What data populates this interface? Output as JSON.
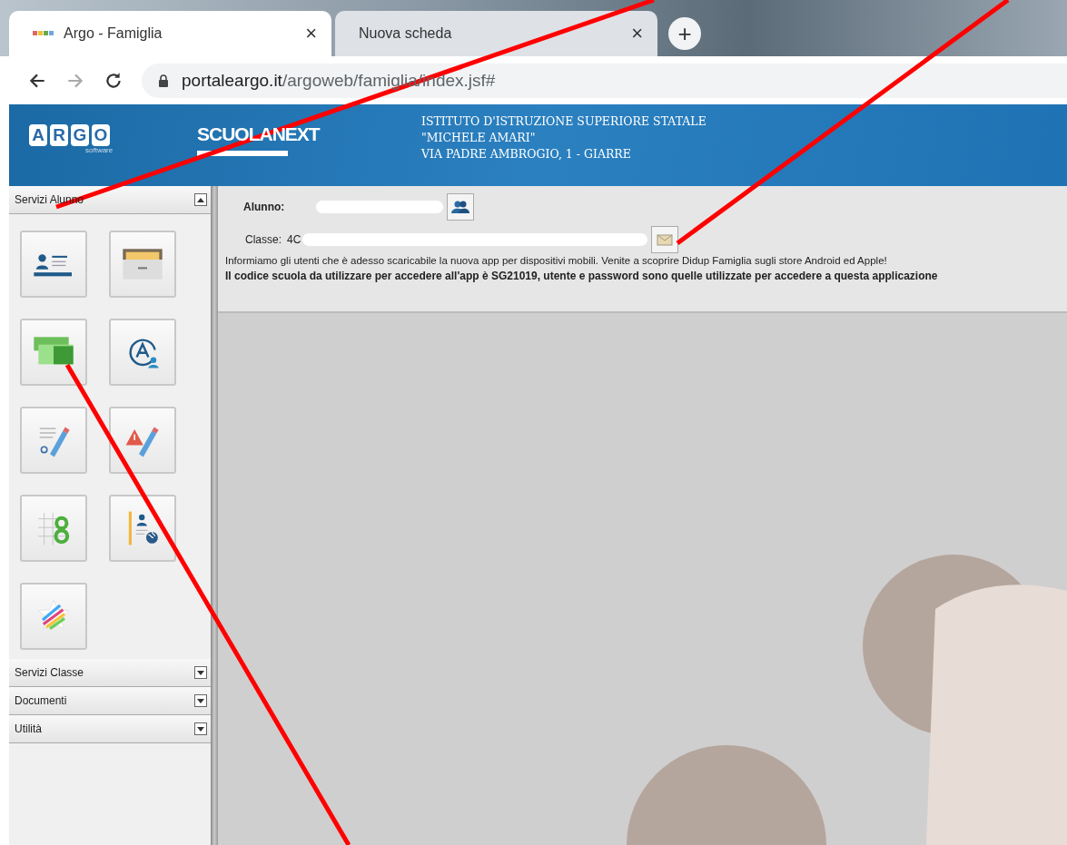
{
  "browser": {
    "tabs": [
      {
        "title": "Argo - Famiglia",
        "close": "×",
        "selected": true
      },
      {
        "title": "Nuova scheda",
        "close": "×",
        "selected": false
      }
    ],
    "new_tab": "+",
    "address": {
      "host": "portaleargo.it",
      "path": "/argoweb/famiglia/index.jsf#"
    }
  },
  "header": {
    "logo_letters": [
      "A",
      "R",
      "G",
      "O"
    ],
    "logo_sub": "software",
    "product": "SCUOLANEXT",
    "school": [
      "ISTITUTO D'ISTRUZIONE SUPERIORE STATALE",
      "\"MICHELE AMARI\"",
      "VIA PADRE AMBROGIO, 1 - GIARRE"
    ]
  },
  "sidebar": {
    "sections": [
      {
        "title": "Servizi Alunno",
        "expanded": true,
        "items": [
          {
            "kind": "card"
          },
          {
            "kind": "drawer"
          },
          {
            "kind": "money"
          },
          {
            "kind": "absence"
          },
          {
            "kind": "grade"
          },
          {
            "kind": "warning"
          },
          {
            "kind": "grid"
          },
          {
            "kind": "globe"
          },
          {
            "kind": "star"
          }
        ]
      },
      {
        "title": "Servizi Classe",
        "expanded": false
      },
      {
        "title": "Documenti",
        "expanded": false
      },
      {
        "title": "Utilità",
        "expanded": false
      }
    ]
  },
  "student": {
    "label": "Alunno:",
    "class_label": "Classe:",
    "class_value": "4C"
  },
  "notice": [
    "Informiamo gli utenti che è adesso scaricabile la nuova app per dispositivi mobili. Venite a scoprire Didup Famiglia sugli store Android ed Apple!",
    "Il codice scuola da utilizzare per accedere all'app è SG21019, utente e password sono quelle utilizzate per accedere a questa applicazione"
  ]
}
